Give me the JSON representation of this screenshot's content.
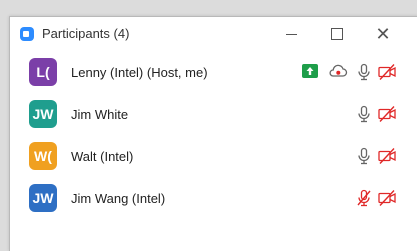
{
  "window": {
    "title": "Participants (4)"
  },
  "colors": {
    "accent": "#2d8cff",
    "muted_red": "#e02828",
    "share_green": "#1e9e4a"
  },
  "participants": [
    {
      "initials": "L(",
      "name": "Lenny (Intel) (Host, me)",
      "avatar_color": "#7b3fa8",
      "sharing": true,
      "recording": true,
      "mic_muted": false,
      "video_off": true
    },
    {
      "initials": "JW",
      "name": "Jim White",
      "avatar_color": "#1f9e8e",
      "sharing": false,
      "recording": false,
      "mic_muted": false,
      "video_off": true
    },
    {
      "initials": "W(",
      "name": "Walt (Intel)",
      "avatar_color": "#f0a020",
      "sharing": false,
      "recording": false,
      "mic_muted": false,
      "video_off": true
    },
    {
      "initials": "JW",
      "name": "Jim Wang (Intel)",
      "avatar_color": "#2e6fc4",
      "sharing": false,
      "recording": false,
      "mic_muted": true,
      "video_off": true
    }
  ]
}
